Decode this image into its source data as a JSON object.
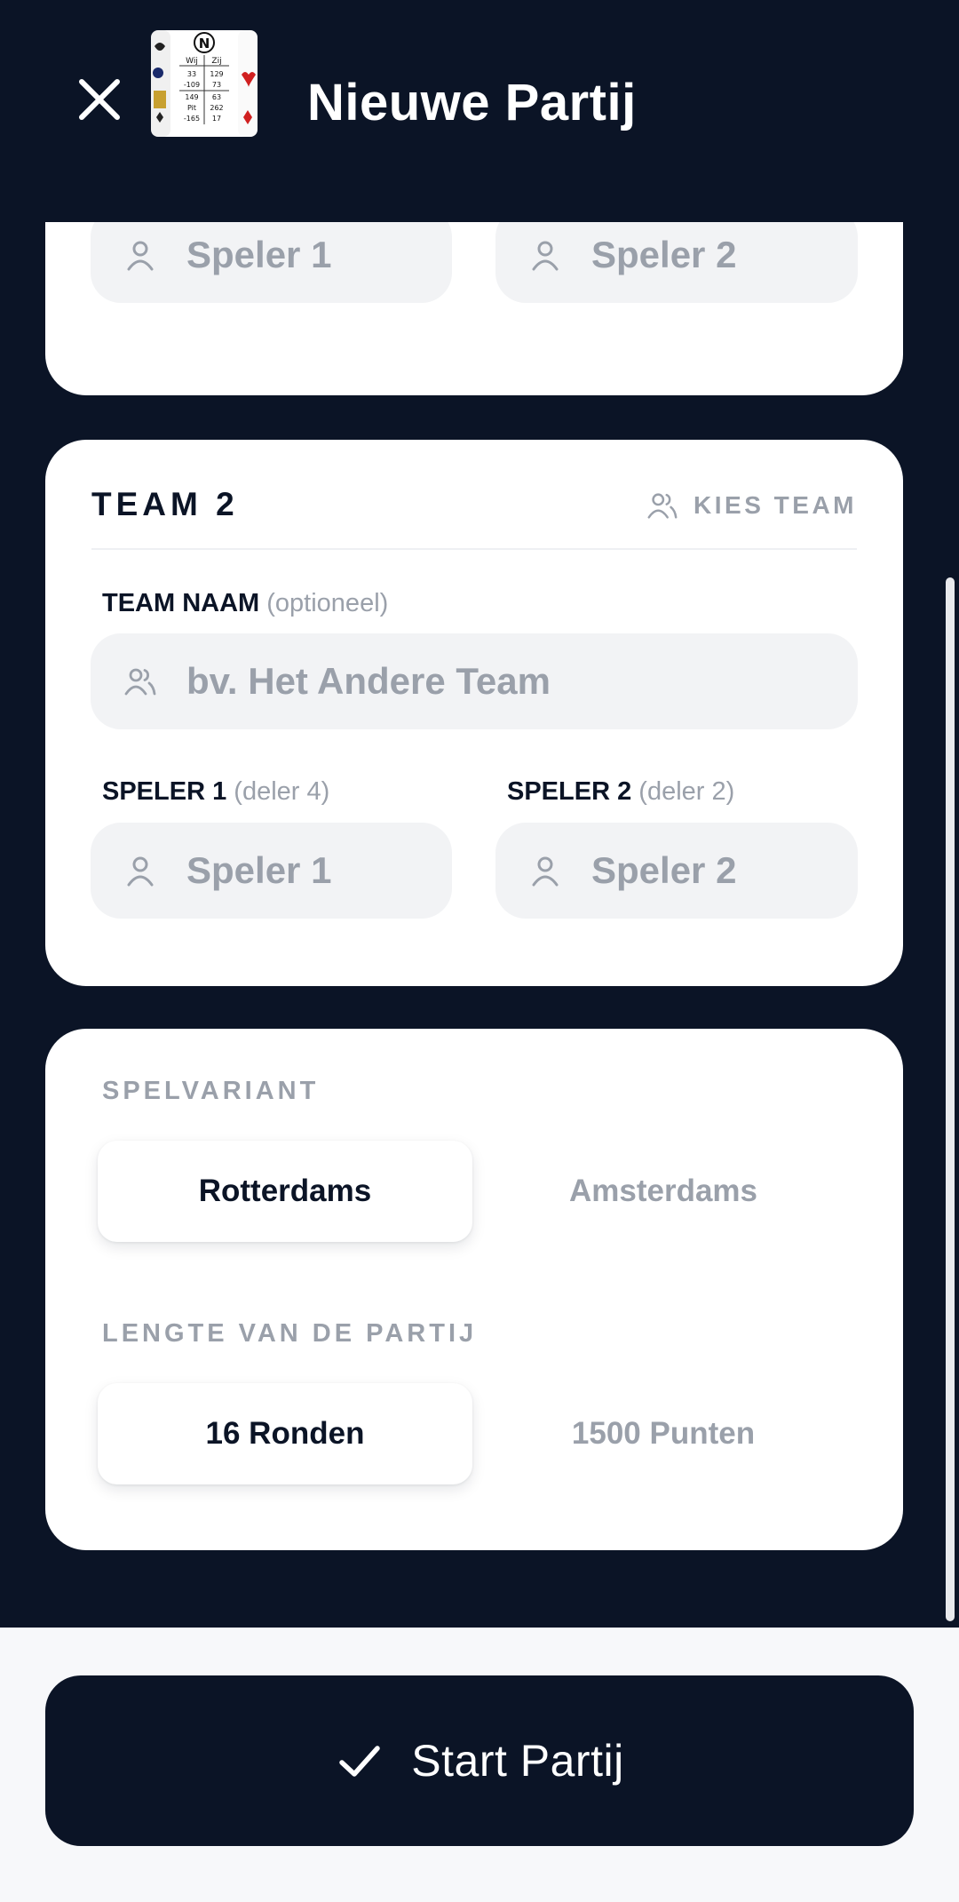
{
  "header": {
    "title": "Nieuwe Partij",
    "close_icon": "close-icon",
    "logo": {
      "letter": "N",
      "col1": "Wij",
      "col2": "Zij",
      "rows": [
        [
          "33",
          "129"
        ],
        [
          "-109",
          "73"
        ],
        [
          "149",
          "63"
        ],
        [
          "Pit",
          "262"
        ],
        [
          "-165",
          "17"
        ]
      ]
    }
  },
  "team1": {
    "player1_placeholder": "Speler 1",
    "player2_placeholder": "Speler 2"
  },
  "team2": {
    "title": "TEAM 2",
    "choose_team": "KIES TEAM",
    "team_name_label": "TEAM NAAM",
    "team_name_optional": "(optioneel)",
    "team_name_placeholder": "bv. Het Andere Team",
    "player1_label": "SPELER 1",
    "player1_hint": "(deler 4)",
    "player1_placeholder": "Speler 1",
    "player2_label": "SPELER 2",
    "player2_hint": "(deler 2)",
    "player2_placeholder": "Speler 2"
  },
  "settings": {
    "variant_label": "SPELVARIANT",
    "variant_options": [
      "Rotterdams",
      "Amsterdams"
    ],
    "variant_selected": "Rotterdams",
    "length_label": "LENGTE VAN DE PARTIJ",
    "length_options": [
      "16 Ronden",
      "1500 Punten"
    ],
    "length_selected": "16 Ronden"
  },
  "footer": {
    "start_label": "Start Partij"
  },
  "colors": {
    "navy": "#0b1426",
    "card": "#ffffff",
    "field": "#f2f3f5",
    "muted": "#9aa0aa"
  }
}
